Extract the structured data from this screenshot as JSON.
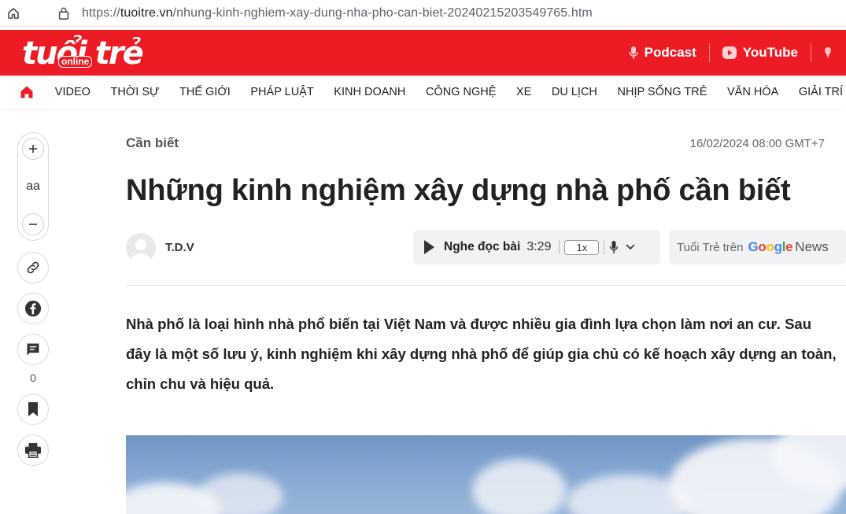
{
  "browser": {
    "url_prefix": "https://",
    "url_host": "tuoitre.vn",
    "url_path": "/nhung-kinh-nghiem-xay-dung-nha-pho-can-biet-20240215203549765.htm"
  },
  "header": {
    "logo_text": "tuổi trẻ",
    "logo_sub": "online",
    "actions": [
      {
        "label": "Podcast",
        "icon": "mic-icon"
      },
      {
        "label": "YouTube",
        "icon": "youtube-icon"
      }
    ],
    "brand_color": "#ed1c24"
  },
  "nav": {
    "items": [
      "VIDEO",
      "THỜI SỰ",
      "THẾ GIỚI",
      "PHÁP LUẬT",
      "KINH DOANH",
      "CÔNG NGHỆ",
      "XE",
      "DU LỊCH",
      "NHỊP SỐNG TRẺ",
      "VĂN HÓA",
      "GIẢI TRÍ"
    ]
  },
  "tools": {
    "font_size_label": "aa",
    "comment_count": "0"
  },
  "article": {
    "category": "Cần biết",
    "date": "16/02/2024 08:00 GMT+7",
    "title": "Những kinh nghiệm xây dựng nhà phố cần biết",
    "author": "T.D.V",
    "audio": {
      "label": "Nghe đọc bài",
      "duration": "3:29",
      "speed": "1x"
    },
    "google_news": {
      "prefix": "Tuổi Trẻ trên",
      "brand": "Google",
      "suffix": "News"
    },
    "sapo": "Nhà phố là loại hình nhà phổ biến tại Việt Nam và được nhiều gia đình lựa chọn làm nơi an cư. Sau đây là một số lưu ý, kinh nghiệm khi xây dựng nhà phố để giúp gia chủ có kế hoạch xây dựng an toàn, chỉn chu và hiệu quả."
  }
}
